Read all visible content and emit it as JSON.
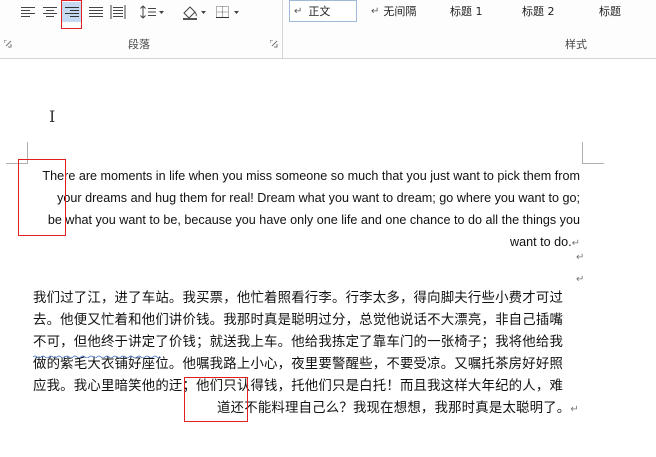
{
  "ribbon": {
    "paragraph_group": {
      "label": "段落",
      "buttons": [
        {
          "name": "align-left-icon"
        },
        {
          "name": "align-center-icon"
        },
        {
          "name": "align-right-icon",
          "selected": true
        },
        {
          "name": "justify-icon"
        },
        {
          "name": "distributed-icon"
        },
        {
          "name": "line-spacing-icon"
        },
        {
          "name": "shading-icon"
        },
        {
          "name": "borders-icon"
        }
      ]
    },
    "styles_group": {
      "label": "样式",
      "items": [
        {
          "label": "正文",
          "prefix": "↵",
          "active": true
        },
        {
          "label": "无间隔",
          "prefix": "↵"
        },
        {
          "label": "标题 1"
        },
        {
          "label": "标题 2"
        },
        {
          "label": "标题"
        }
      ]
    }
  },
  "document": {
    "english_lines": [
      "There are moments in life when you miss someone so much that you just want to pick them from",
      "your dreams and hug them for real! Dream what you want to dream; go where you want to go;",
      "be what you want to be, because you have only one life and one chance to do all the things you",
      "want to do."
    ],
    "paragraph_mark": "↵",
    "chinese_lines": [
      "我们过了江，进了车站。我买票，他忙着照看行李。行李太多，得向脚夫行些小费才可过",
      "去。他便又忙着和他们讲价钱。我那时真是聪明过分，总觉他说话不大漂亮，非自己插嘴",
      "不可，但他终于讲定了价钱；就送我上车。他给我拣定了靠车门的一张椅子；我将他给我",
      "做的紫毛大衣铺好座位。他嘱我路上小心，夜里要警醒些，不要受凉。又嘱托茶房好好照",
      "应我。我心里暗笑他的迂；他们只认得钱，托他们只是白托！而且我这样大年纪的人，难",
      "道还不能料理自己么？我现在想想，我那时真是太聪明了。"
    ]
  }
}
